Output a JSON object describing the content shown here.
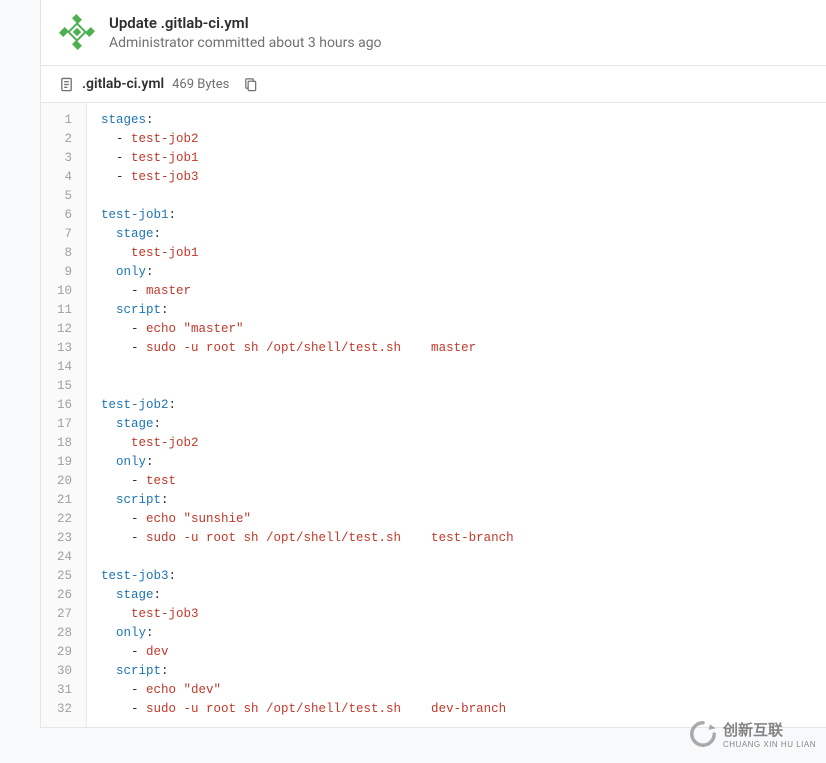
{
  "commit": {
    "title": "Update .gitlab-ci.yml",
    "author_role": "Administrator",
    "action": "committed",
    "time": "about 3 hours ago"
  },
  "file": {
    "name": ".gitlab-ci.yml",
    "size": "469 Bytes"
  },
  "code_lines": [
    [
      {
        "t": "key",
        "v": "stages"
      },
      {
        "t": "p",
        "v": ":"
      }
    ],
    [
      {
        "t": "p",
        "v": "  - "
      },
      {
        "t": "str",
        "v": "test-job2"
      }
    ],
    [
      {
        "t": "p",
        "v": "  - "
      },
      {
        "t": "str",
        "v": "test-job1"
      }
    ],
    [
      {
        "t": "p",
        "v": "  - "
      },
      {
        "t": "str",
        "v": "test-job3"
      }
    ],
    [
      {
        "t": "p",
        "v": ""
      }
    ],
    [
      {
        "t": "key",
        "v": "test-job1"
      },
      {
        "t": "p",
        "v": ":"
      }
    ],
    [
      {
        "t": "p",
        "v": "  "
      },
      {
        "t": "key",
        "v": "stage"
      },
      {
        "t": "p",
        "v": ":"
      }
    ],
    [
      {
        "t": "p",
        "v": "    "
      },
      {
        "t": "str",
        "v": "test-job1"
      }
    ],
    [
      {
        "t": "p",
        "v": "  "
      },
      {
        "t": "key",
        "v": "only"
      },
      {
        "t": "p",
        "v": ":"
      }
    ],
    [
      {
        "t": "p",
        "v": "    - "
      },
      {
        "t": "str",
        "v": "master"
      }
    ],
    [
      {
        "t": "p",
        "v": "  "
      },
      {
        "t": "key",
        "v": "script"
      },
      {
        "t": "p",
        "v": ":"
      }
    ],
    [
      {
        "t": "p",
        "v": "    - "
      },
      {
        "t": "str",
        "v": "echo \"master\""
      }
    ],
    [
      {
        "t": "p",
        "v": "    - "
      },
      {
        "t": "str",
        "v": "sudo -u root sh /opt/shell/test.sh    master"
      }
    ],
    [
      {
        "t": "p",
        "v": ""
      }
    ],
    [
      {
        "t": "p",
        "v": ""
      }
    ],
    [
      {
        "t": "key",
        "v": "test-job2"
      },
      {
        "t": "p",
        "v": ":"
      }
    ],
    [
      {
        "t": "p",
        "v": "  "
      },
      {
        "t": "key",
        "v": "stage"
      },
      {
        "t": "p",
        "v": ":"
      }
    ],
    [
      {
        "t": "p",
        "v": "    "
      },
      {
        "t": "str",
        "v": "test-job2"
      }
    ],
    [
      {
        "t": "p",
        "v": "  "
      },
      {
        "t": "key",
        "v": "only"
      },
      {
        "t": "p",
        "v": ":"
      }
    ],
    [
      {
        "t": "p",
        "v": "    - "
      },
      {
        "t": "str",
        "v": "test"
      }
    ],
    [
      {
        "t": "p",
        "v": "  "
      },
      {
        "t": "key",
        "v": "script"
      },
      {
        "t": "p",
        "v": ":"
      }
    ],
    [
      {
        "t": "p",
        "v": "    - "
      },
      {
        "t": "str",
        "v": "echo \"sunshie\""
      }
    ],
    [
      {
        "t": "p",
        "v": "    - "
      },
      {
        "t": "str",
        "v": "sudo -u root sh /opt/shell/test.sh    test-branch"
      }
    ],
    [
      {
        "t": "p",
        "v": ""
      }
    ],
    [
      {
        "t": "key",
        "v": "test-job3"
      },
      {
        "t": "p",
        "v": ":"
      }
    ],
    [
      {
        "t": "p",
        "v": "  "
      },
      {
        "t": "key",
        "v": "stage"
      },
      {
        "t": "p",
        "v": ":"
      }
    ],
    [
      {
        "t": "p",
        "v": "    "
      },
      {
        "t": "str",
        "v": "test-job3"
      }
    ],
    [
      {
        "t": "p",
        "v": "  "
      },
      {
        "t": "key",
        "v": "only"
      },
      {
        "t": "p",
        "v": ":"
      }
    ],
    [
      {
        "t": "p",
        "v": "    - "
      },
      {
        "t": "str",
        "v": "dev"
      }
    ],
    [
      {
        "t": "p",
        "v": "  "
      },
      {
        "t": "key",
        "v": "script"
      },
      {
        "t": "p",
        "v": ":"
      }
    ],
    [
      {
        "t": "p",
        "v": "    - "
      },
      {
        "t": "str",
        "v": "echo \"dev\""
      }
    ],
    [
      {
        "t": "p",
        "v": "    - "
      },
      {
        "t": "str",
        "v": "sudo -u root sh /opt/shell/test.sh    dev-branch"
      }
    ]
  ],
  "watermark": {
    "cn": "创新互联",
    "py": "CHUANG XIN HU LIAN"
  }
}
